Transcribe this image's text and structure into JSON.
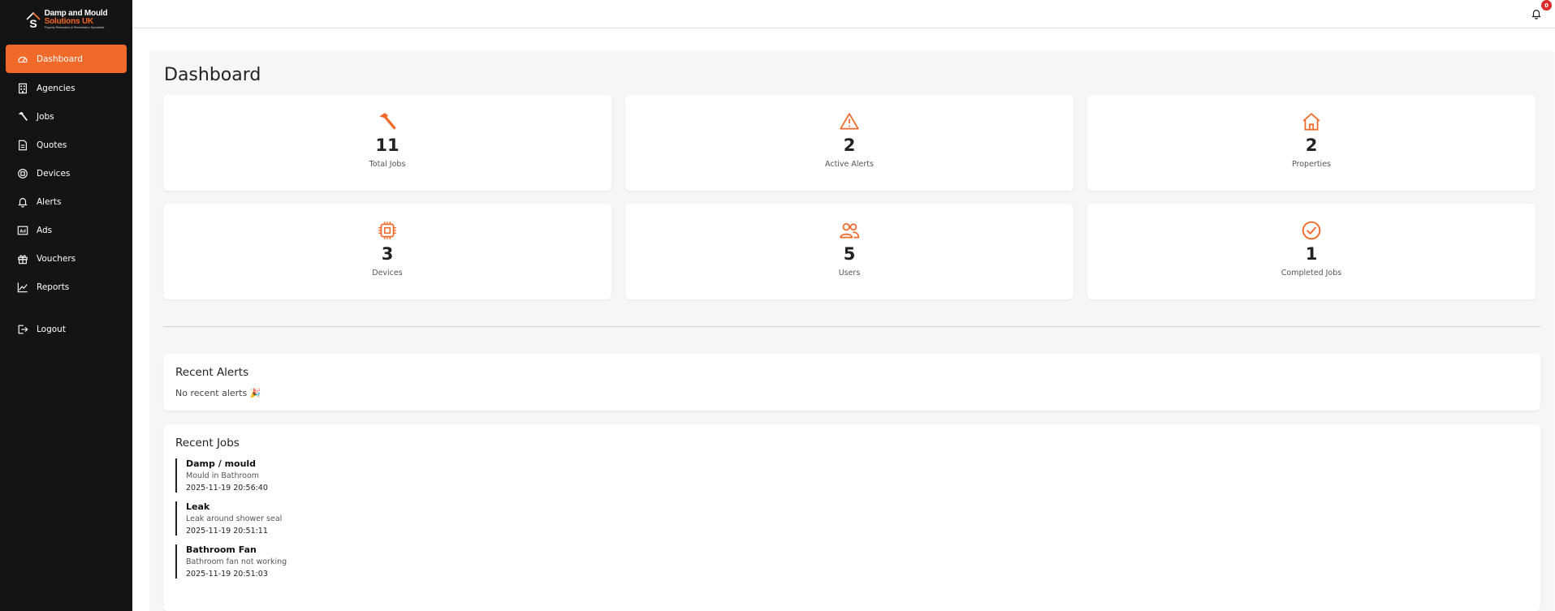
{
  "brand": {
    "line1": "Damp and Mould",
    "line2": "Solutions UK",
    "line3": "Property Restoration & Remediation Specialists",
    "accent": "#f26a2a",
    "sidebar_bg": "#141414"
  },
  "sidebar": {
    "items": [
      {
        "label": "Dashboard",
        "icon": "dashboard-gauge-icon",
        "active": true
      },
      {
        "label": "Agencies",
        "icon": "building-icon"
      },
      {
        "label": "Jobs",
        "icon": "hammer-icon"
      },
      {
        "label": "Quotes",
        "icon": "document-icon"
      },
      {
        "label": "Devices",
        "icon": "device-icon"
      },
      {
        "label": "Alerts",
        "icon": "bell-icon"
      },
      {
        "label": "Ads",
        "icon": "ad-icon"
      },
      {
        "label": "Vouchers",
        "icon": "gift-icon"
      },
      {
        "label": "Reports",
        "icon": "chart-line-icon"
      }
    ],
    "logout": {
      "label": "Logout",
      "icon": "logout-icon"
    }
  },
  "topbar": {
    "notification_count": "0"
  },
  "page": {
    "title": "Dashboard"
  },
  "stats": [
    {
      "value": "11",
      "label": "Total Jobs",
      "icon": "hammer-icon"
    },
    {
      "value": "2",
      "label": "Active Alerts",
      "icon": "warning-triangle-icon"
    },
    {
      "value": "2",
      "label": "Properties",
      "icon": "house-icon"
    },
    {
      "value": "3",
      "label": "Devices",
      "icon": "chip-icon"
    },
    {
      "value": "5",
      "label": "Users",
      "icon": "users-icon"
    },
    {
      "value": "1",
      "label": "Completed Jobs",
      "icon": "check-circle-icon"
    }
  ],
  "recent_alerts": {
    "title": "Recent Alerts",
    "empty": "No recent alerts 🎉"
  },
  "recent_jobs": {
    "title": "Recent Jobs",
    "items": [
      {
        "title": "Damp / mould",
        "desc": "Mould in Bathroom",
        "time": "2025-11-19 20:56:40"
      },
      {
        "title": "Leak",
        "desc": "Leak around shower seal",
        "time": "2025-11-19 20:51:11"
      },
      {
        "title": "Bathroom Fan",
        "desc": "Bathroom fan not working",
        "time": "2025-11-19 20:51:03"
      }
    ]
  }
}
